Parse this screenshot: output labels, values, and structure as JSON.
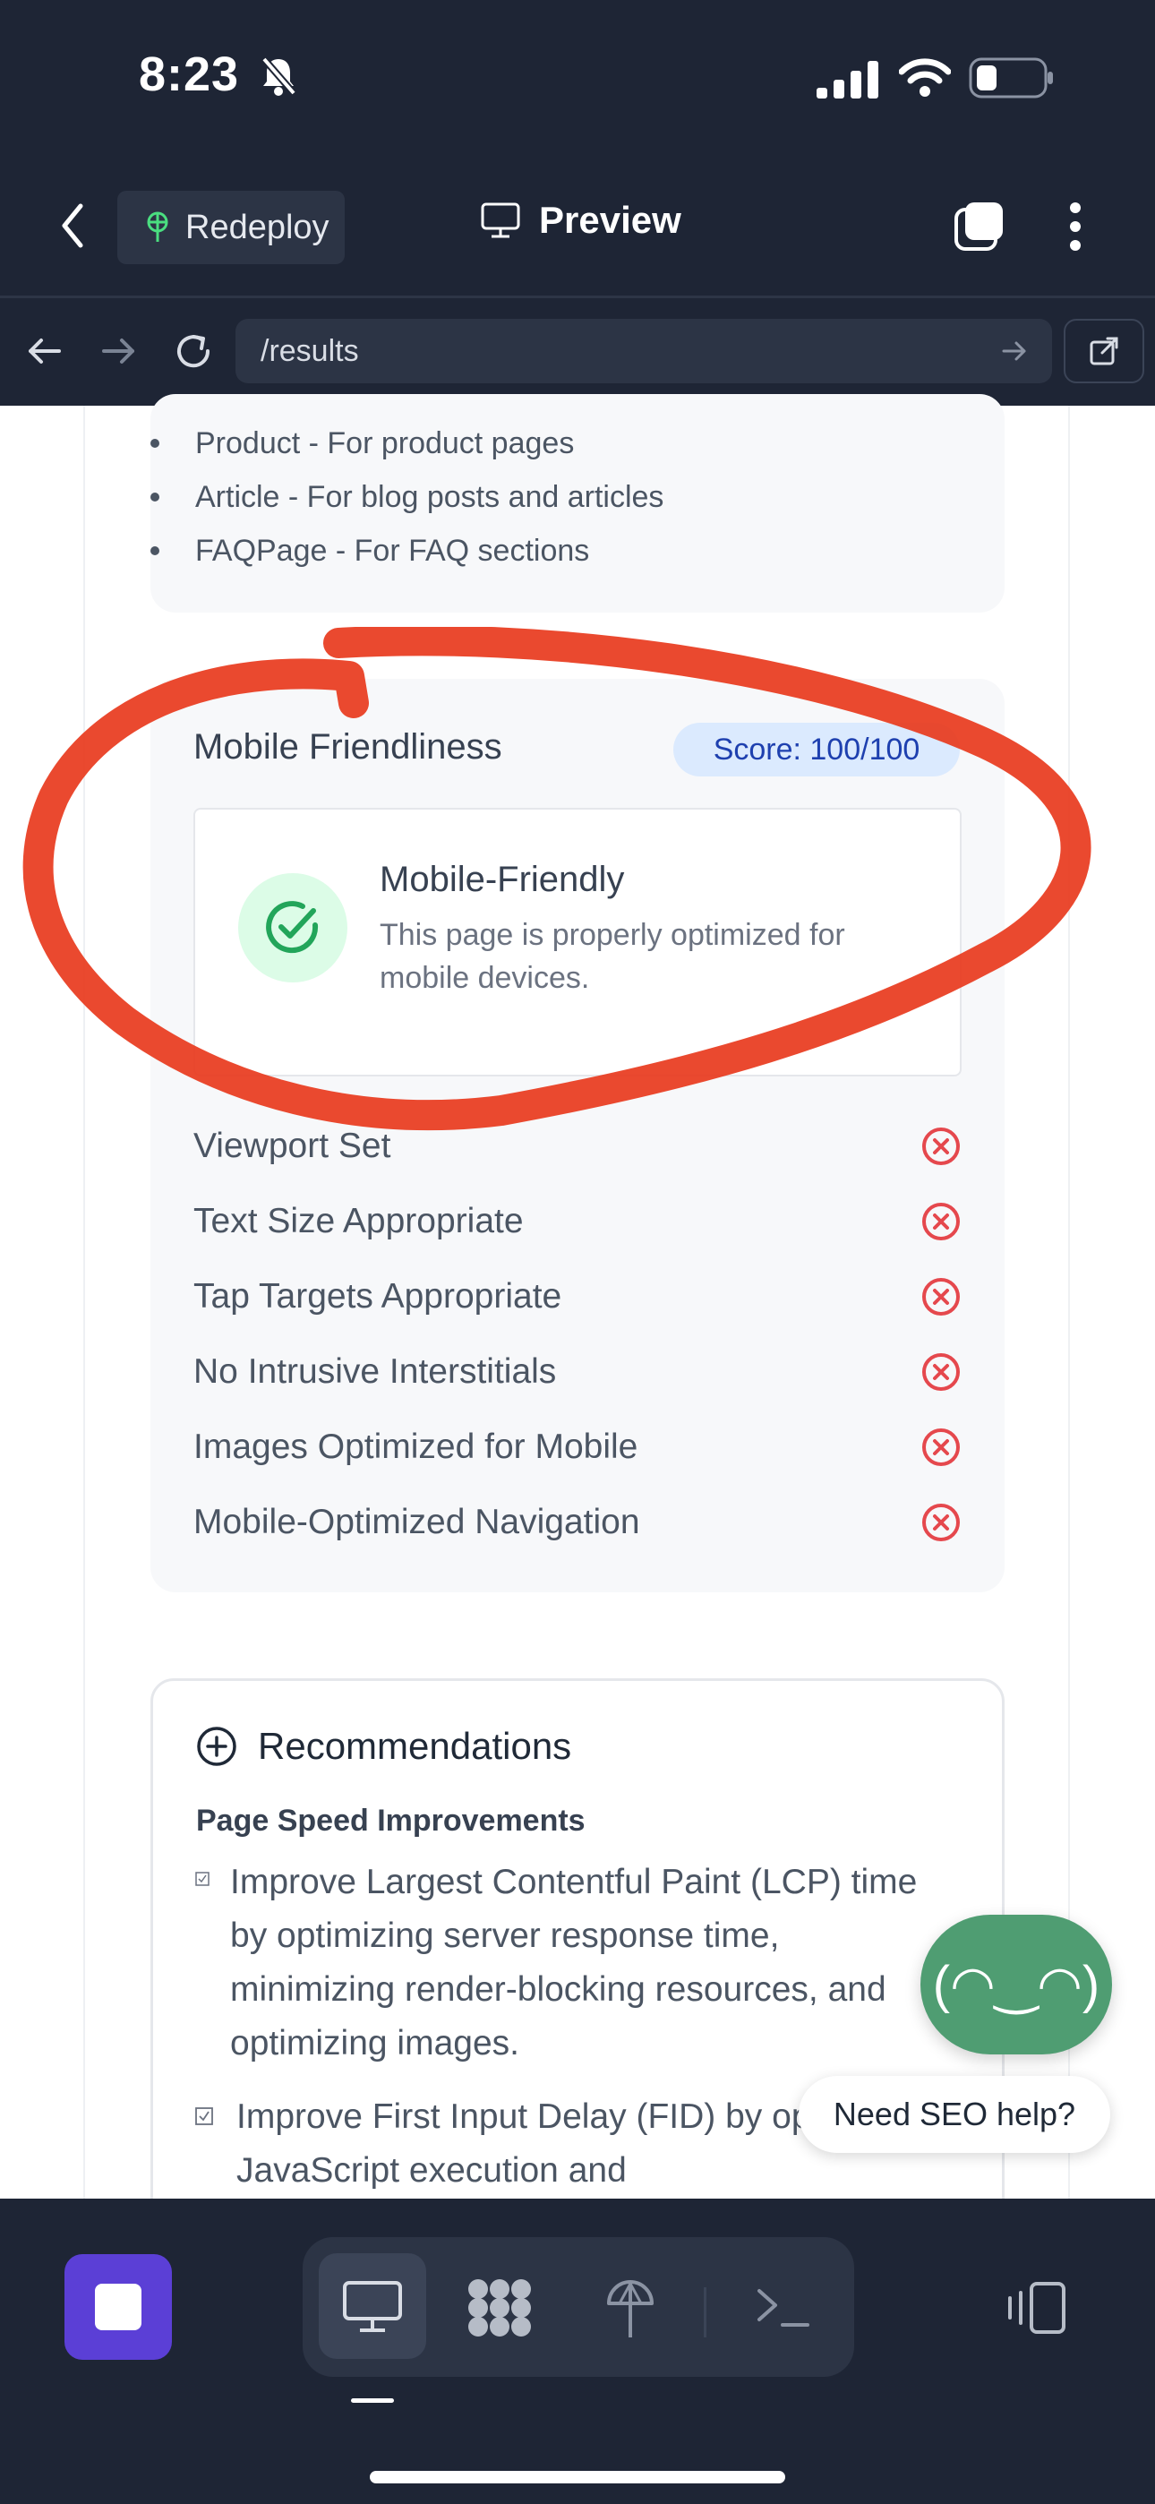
{
  "status_bar": {
    "time": "8:23"
  },
  "header": {
    "redeploy_label": "Redeploy",
    "preview_label": "Preview"
  },
  "browser": {
    "url": "/results"
  },
  "schema_list": [
    "Product - For product pages",
    "Article - For blog posts and articles",
    "FAQPage - For FAQ sections"
  ],
  "mobile_friendliness": {
    "heading": "Mobile Friendliness",
    "score": "Score: 100/100",
    "card_title": "Mobile-Friendly",
    "card_desc": "This page is properly optimized for mobile devices.",
    "checks": [
      "Viewport Set",
      "Text Size Appropriate",
      "Tap Targets Appropriate",
      "No Intrusive Interstitials",
      "Images Optimized for Mobile",
      "Mobile-Optimized Navigation"
    ]
  },
  "recommendations": {
    "title": "Recommendations",
    "subtitle": "Page Speed Improvements",
    "items": [
      "Improve Largest Contentful Paint (LCP) time by optimizing server response time, minimizing render-blocking resources, and optimizing images.",
      "Improve First Input Delay (FID) by optimizing JavaScript execution and"
    ]
  },
  "help": {
    "fab_face": "(◠‿◠)",
    "bubble": "Need SEO help?"
  },
  "colors": {
    "annotation": "#e8391d",
    "success": "#22a55a",
    "error": "#e5484d",
    "accent": "#5b3fd6"
  }
}
